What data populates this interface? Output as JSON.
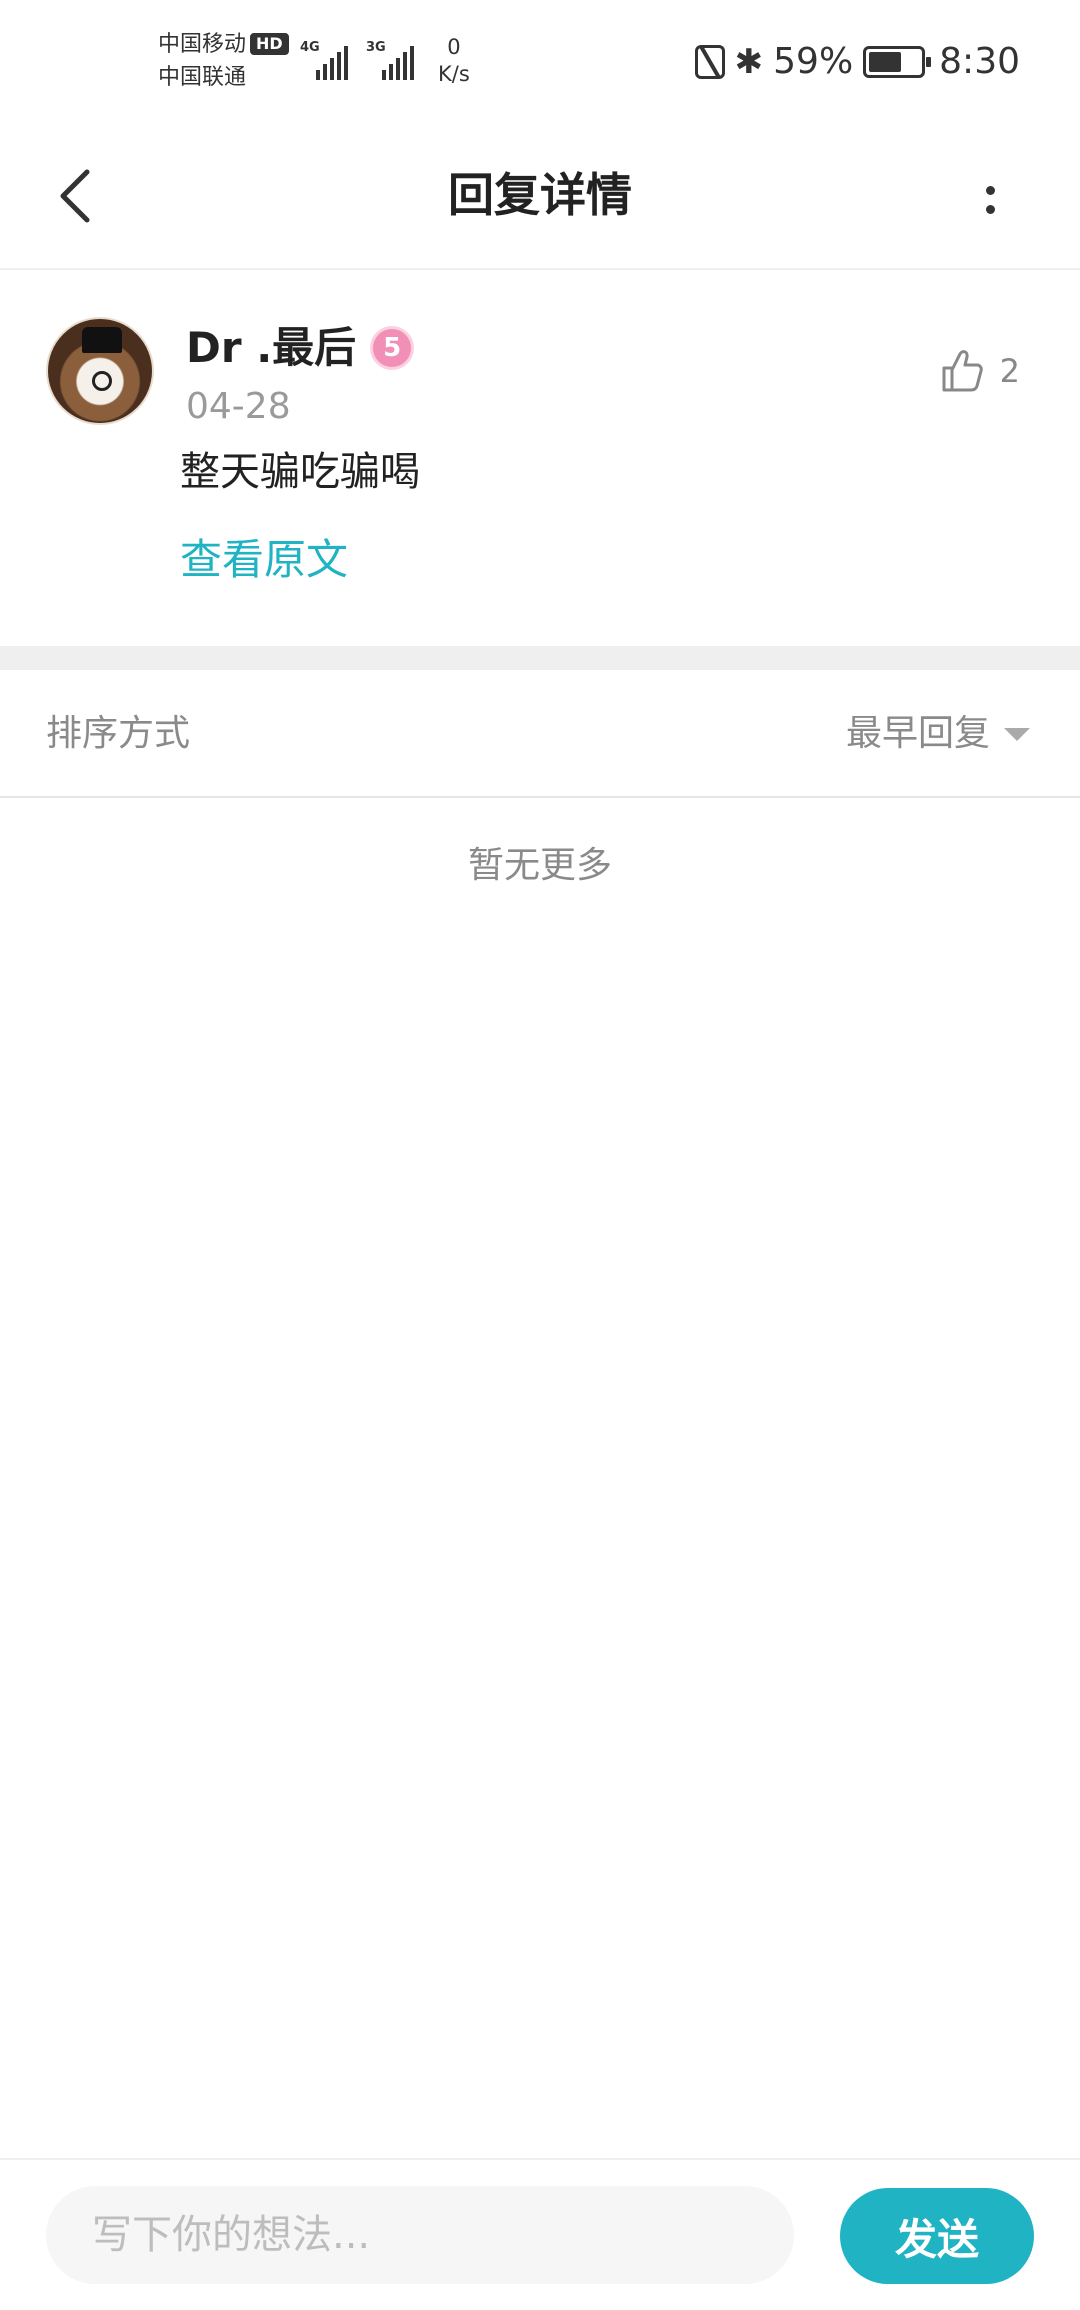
{
  "status_bar": {
    "carrier_1": "中国移动",
    "carrier_1_badge": "HD",
    "carrier_2": "中国联通",
    "signal_1_tag": "4G",
    "signal_2_tag": "3G",
    "net_speed_value": "0",
    "net_speed_unit": "K/s",
    "battery_percent": "59%",
    "time": "8:30",
    "icons": [
      "nfc-icon",
      "bluetooth-icon",
      "battery-icon"
    ]
  },
  "nav": {
    "title": "回复详情",
    "back_icon": "chevron-left-icon",
    "more_icon": "more-vertical-icon"
  },
  "comment": {
    "username": "Dr .最后",
    "level": "5",
    "date": "04-28",
    "text": "整天骗吃骗喝",
    "view_original": "查看原文",
    "like_count": "2",
    "like_icon": "thumbs-up-icon"
  },
  "sort": {
    "label": "排序方式",
    "selected": "最早回复"
  },
  "replies": {
    "empty_text": "暂无更多"
  },
  "reply_bar": {
    "placeholder": "写下你的想法...",
    "send_label": "发送"
  },
  "colors": {
    "accent": "#1fb3c4",
    "level_badge": "#f28fb6",
    "muted_text": "#8a8a8a",
    "divider": "#efefef"
  }
}
